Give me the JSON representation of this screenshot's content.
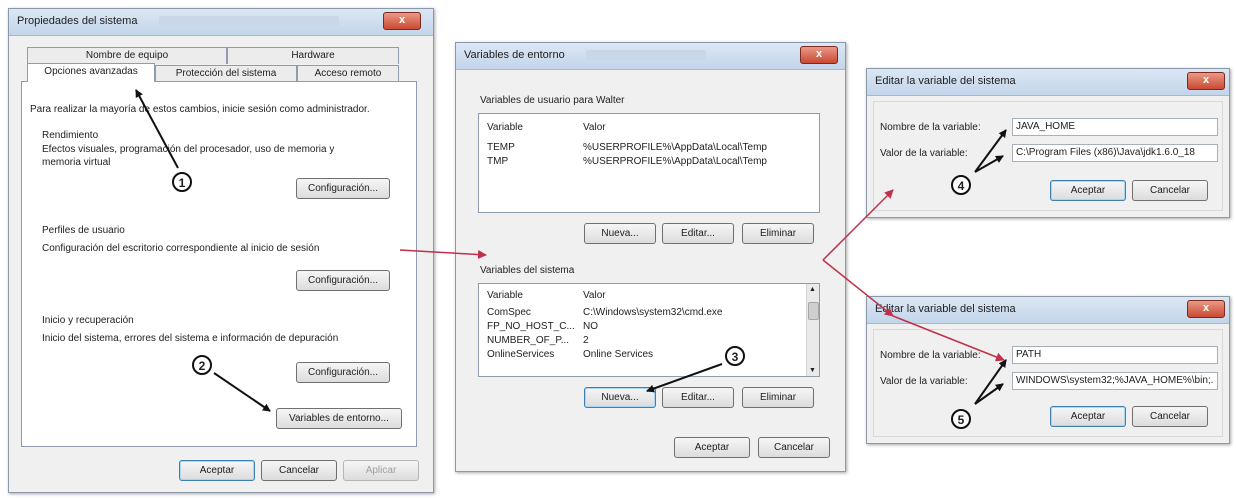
{
  "dialog1": {
    "title": "Propiedades del sistema",
    "close": "x",
    "tabs_top": [
      "Nombre de equipo",
      "Hardware"
    ],
    "tabs_bottom": [
      "Opciones avanzadas",
      "Protección del sistema",
      "Acceso remoto"
    ],
    "admin_note": "Para realizar la mayoría de estos cambios, inicie sesión como administrador.",
    "performance": {
      "heading": "Rendimiento",
      "desc_line1": "Efectos visuales, programación del procesador, uso de memoria y",
      "desc_line2": "memoria virtual",
      "button": "Configuración..."
    },
    "profiles": {
      "heading": "Perfiles de usuario",
      "desc": "Configuración del escritorio correspondiente al inicio de sesión",
      "button": "Configuración..."
    },
    "startup": {
      "heading": "Inicio y recuperación",
      "desc": "Inicio del sistema, errores del sistema e información de depuración",
      "button": "Configuración..."
    },
    "env_button": "Variables de entorno...",
    "ok": "Aceptar",
    "cancel": "Cancelar",
    "apply": "Aplicar"
  },
  "dialog2": {
    "title": "Variables de entorno",
    "close": "x",
    "user_section": "Variables de usuario para Walter",
    "col_variable": "Variable",
    "col_value": "Valor",
    "user_vars": [
      {
        "name": "TEMP",
        "value": "%USERPROFILE%\\AppData\\Local\\Temp"
      },
      {
        "name": "TMP",
        "value": "%USERPROFILE%\\AppData\\Local\\Temp"
      }
    ],
    "user_buttons": {
      "new": "Nueva...",
      "edit": "Editar...",
      "delete": "Eliminar"
    },
    "system_section": "Variables del sistema",
    "system_vars": [
      {
        "name": "ComSpec",
        "value": "C:\\Windows\\system32\\cmd.exe"
      },
      {
        "name": "FP_NO_HOST_C...",
        "value": "NO"
      },
      {
        "name": "NUMBER_OF_P...",
        "value": "2"
      },
      {
        "name": "OnlineServices",
        "value": "Online Services"
      }
    ],
    "system_buttons": {
      "new": "Nueva...",
      "edit": "Editar...",
      "delete": "Eliminar"
    },
    "ok": "Aceptar",
    "cancel": "Cancelar"
  },
  "dialog3": {
    "title": "Editar la variable del sistema",
    "close": "x",
    "name_label": "Nombre de la variable:",
    "value_label": "Valor de la variable:",
    "name_value": "JAVA_HOME",
    "value_value": "C:\\Program Files (x86)\\Java\\jdk1.6.0_18",
    "ok": "Aceptar",
    "cancel": "Cancelar"
  },
  "dialog4": {
    "title": "Editar la variable del sistema",
    "close": "x",
    "name_label": "Nombre de la variable:",
    "value_label": "Valor de la variable:",
    "name_value": "PATH",
    "value_value": "WINDOWS\\system32;%JAVA_HOME%\\bin;.",
    "ok": "Aceptar",
    "cancel": "Cancelar"
  },
  "steps": [
    "1",
    "2",
    "3",
    "4",
    "5"
  ],
  "colors": {
    "black_arrow": "#111111",
    "red_arrow": "#c0304a"
  }
}
